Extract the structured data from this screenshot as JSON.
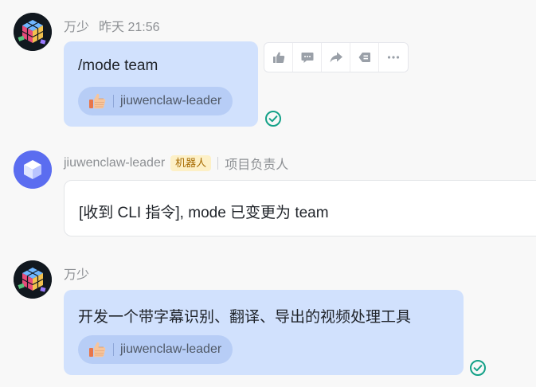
{
  "messages": [
    {
      "sender": "万少",
      "time": "昨天 21:56",
      "text": "/mode team",
      "reaction": {
        "emoji": "thumbs-up-icon",
        "user": "jiuwenclaw-leader"
      },
      "read": true
    },
    {
      "sender": "jiuwenclaw-leader",
      "bot_tag": "机器人",
      "role": "项目负责人",
      "text": "[收到 CLI 指令], mode 已变更为 team"
    },
    {
      "sender": "万少",
      "text": "开发一个带字幕识别、翻译、导出的视频处理工具",
      "reaction": {
        "emoji": "thumbs-up-icon",
        "user": "jiuwenclaw-leader"
      },
      "read": true
    }
  ],
  "toolbar": {
    "actions": [
      "thumbs-up-icon",
      "comment-icon",
      "forward-icon",
      "tag-icon",
      "more-icon"
    ]
  },
  "colors": {
    "bubble_self": "#d1e1fd",
    "bubble_bot": "#ffffff",
    "reaction_pill": "#b7cdf6",
    "bot_tag_bg": "#fdf0c6",
    "bot_tag_text": "#a66a00",
    "read_check": "#14a188",
    "bot_avatar": "#5b6df0"
  }
}
